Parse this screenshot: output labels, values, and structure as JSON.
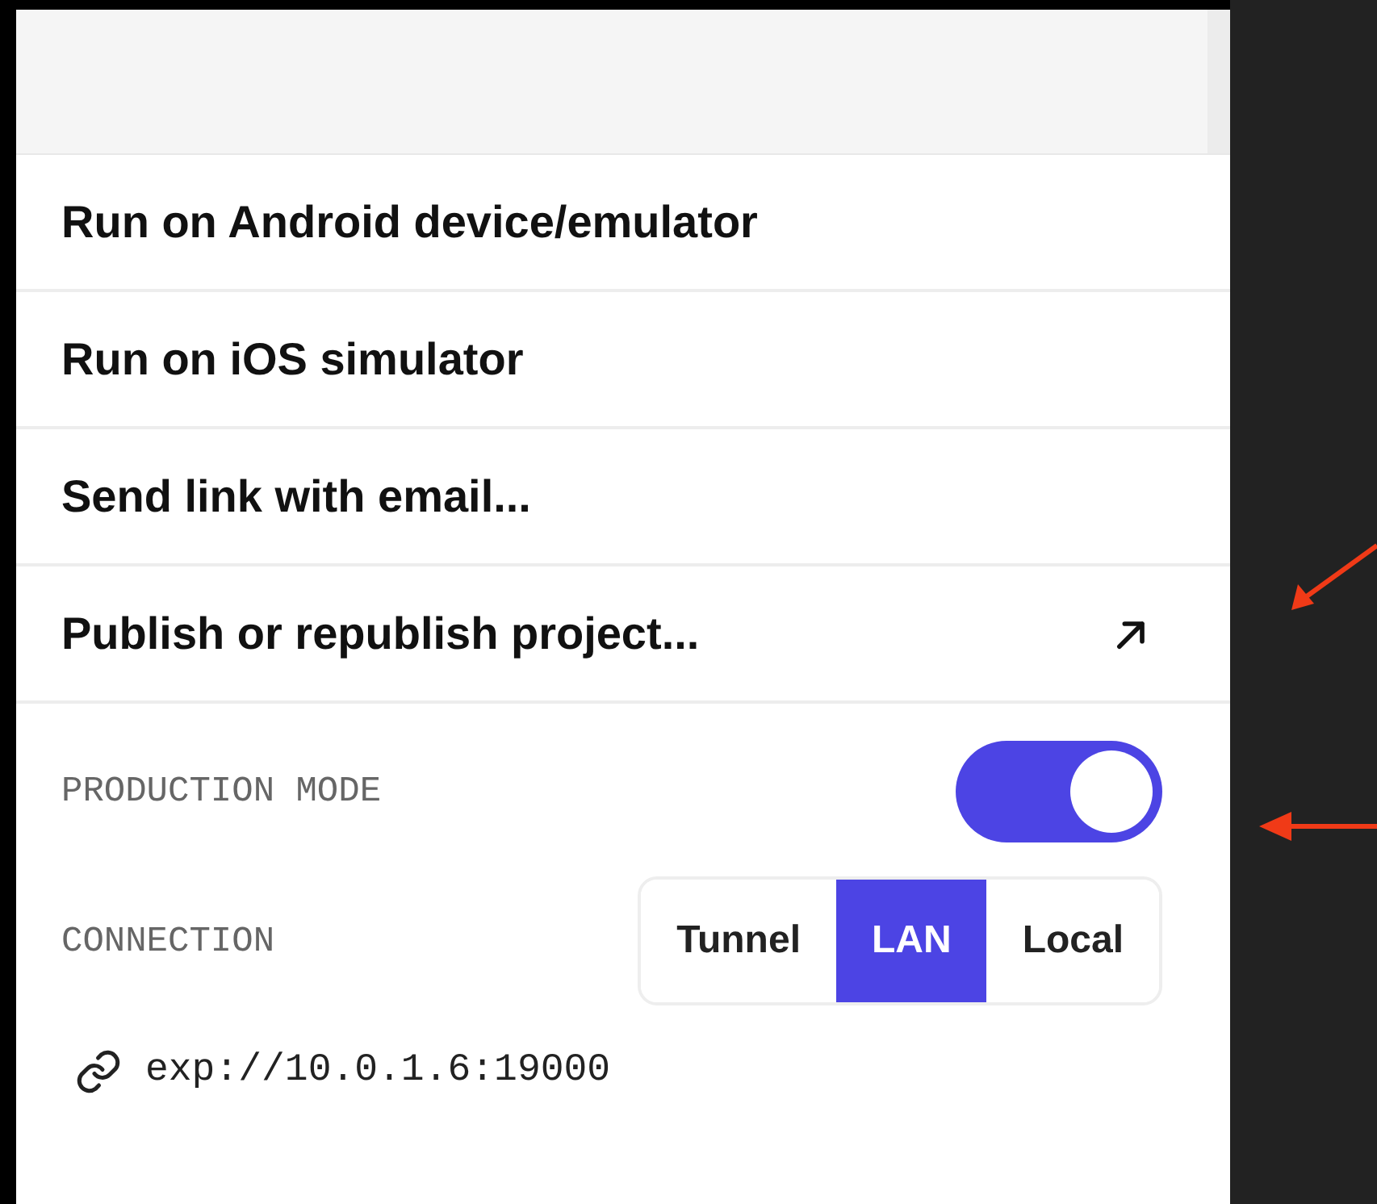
{
  "menu_items": [
    {
      "label": "Run on Android device/emulator",
      "external": false
    },
    {
      "label": "Run on iOS simulator",
      "external": false
    },
    {
      "label": "Send link with email...",
      "external": false
    },
    {
      "label": "Publish or republish project...",
      "external": true
    }
  ],
  "production_mode": {
    "label": "PRODUCTION MODE",
    "on": true
  },
  "connection": {
    "label": "CONNECTION",
    "options": [
      {
        "label": "Tunnel",
        "selected": false
      },
      {
        "label": "LAN",
        "selected": true
      },
      {
        "label": "Local",
        "selected": false
      }
    ]
  },
  "url": "exp://10.0.1.6:19000"
}
